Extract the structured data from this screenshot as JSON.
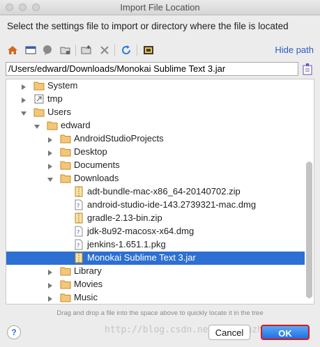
{
  "window": {
    "title": "Import File Location"
  },
  "description": "Select the settings file to import or directory where the file is located",
  "toolbar": {
    "buttons": [
      "home-icon",
      "desktop-icon",
      "project-icon",
      "module-icon",
      "new-folder-icon",
      "delete-icon",
      "refresh-icon",
      "show-hidden-icon"
    ],
    "hide_path": "Hide path"
  },
  "path": {
    "value": "/Users/edward/Downloads/Monokai Sublime Text 3.jar"
  },
  "tree": {
    "rows": [
      {
        "label": "System",
        "depth": 1,
        "kind": "folder",
        "expanded": false
      },
      {
        "label": "tmp",
        "depth": 1,
        "kind": "link-folder",
        "expanded": false
      },
      {
        "label": "Users",
        "depth": 1,
        "kind": "folder",
        "expanded": true
      },
      {
        "label": "edward",
        "depth": 2,
        "kind": "folder",
        "expanded": true
      },
      {
        "label": "AndroidStudioProjects",
        "depth": 3,
        "kind": "folder",
        "expanded": false
      },
      {
        "label": "Desktop",
        "depth": 3,
        "kind": "folder",
        "expanded": false
      },
      {
        "label": "Documents",
        "depth": 3,
        "kind": "folder",
        "expanded": false
      },
      {
        "label": "Downloads",
        "depth": 3,
        "kind": "folder",
        "expanded": true
      },
      {
        "label": "adt-bundle-mac-x86_64-20140702.zip",
        "depth": 4,
        "kind": "archive"
      },
      {
        "label": "android-studio-ide-143.2739321-mac.dmg",
        "depth": 4,
        "kind": "file"
      },
      {
        "label": "gradle-2.13-bin.zip",
        "depth": 4,
        "kind": "archive"
      },
      {
        "label": "jdk-8u92-macosx-x64.dmg",
        "depth": 4,
        "kind": "file"
      },
      {
        "label": "jenkins-1.651.1.pkg",
        "depth": 4,
        "kind": "file"
      },
      {
        "label": "Monokai Sublime Text 3.jar",
        "depth": 4,
        "kind": "archive",
        "selected": true
      },
      {
        "label": "Library",
        "depth": 3,
        "kind": "folder",
        "expanded": false
      },
      {
        "label": "Movies",
        "depth": 3,
        "kind": "folder",
        "expanded": false
      },
      {
        "label": "Music",
        "depth": 3,
        "kind": "folder",
        "expanded": false
      }
    ]
  },
  "hint": "Drag and drop a file into the space above to quickly locate it in the tree",
  "footer": {
    "help": "?",
    "cancel": "Cancel",
    "ok": "OK",
    "watermark": "http://blog.csdn.net/lixingzhiling1"
  },
  "colors": {
    "selection": "#2d6fd2",
    "folder": "#e5a53a",
    "link": "#2c5dbf",
    "ok_border": "#d8161b"
  }
}
